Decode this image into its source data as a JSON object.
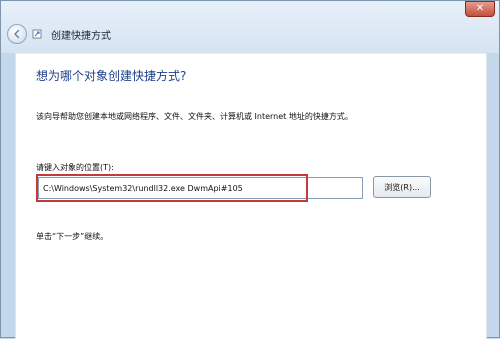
{
  "window": {
    "title": "创建快捷方式"
  },
  "header": {
    "title": "创建快捷方式"
  },
  "main": {
    "heading": "想为哪个对象创建快捷方式?",
    "description": "该向导帮助您创建本地或网络程序、文件、文件夹、计算机或 Internet 地址的快捷方式。",
    "field_label": "请键入对象的位置(T):",
    "field_value": "C:\\Windows\\System32\\rundll32.exe DwmApi#105",
    "browse_label": "浏览(R)...",
    "hint": "单击“下一步”继续。"
  },
  "icons": {
    "back": "back-arrow-icon",
    "wizard": "shortcut-wizard-icon",
    "close": "close-icon"
  },
  "colors": {
    "heading": "#1d3f8a",
    "highlight": "#c23a3a",
    "window_chrome": "#c5d7ea"
  }
}
